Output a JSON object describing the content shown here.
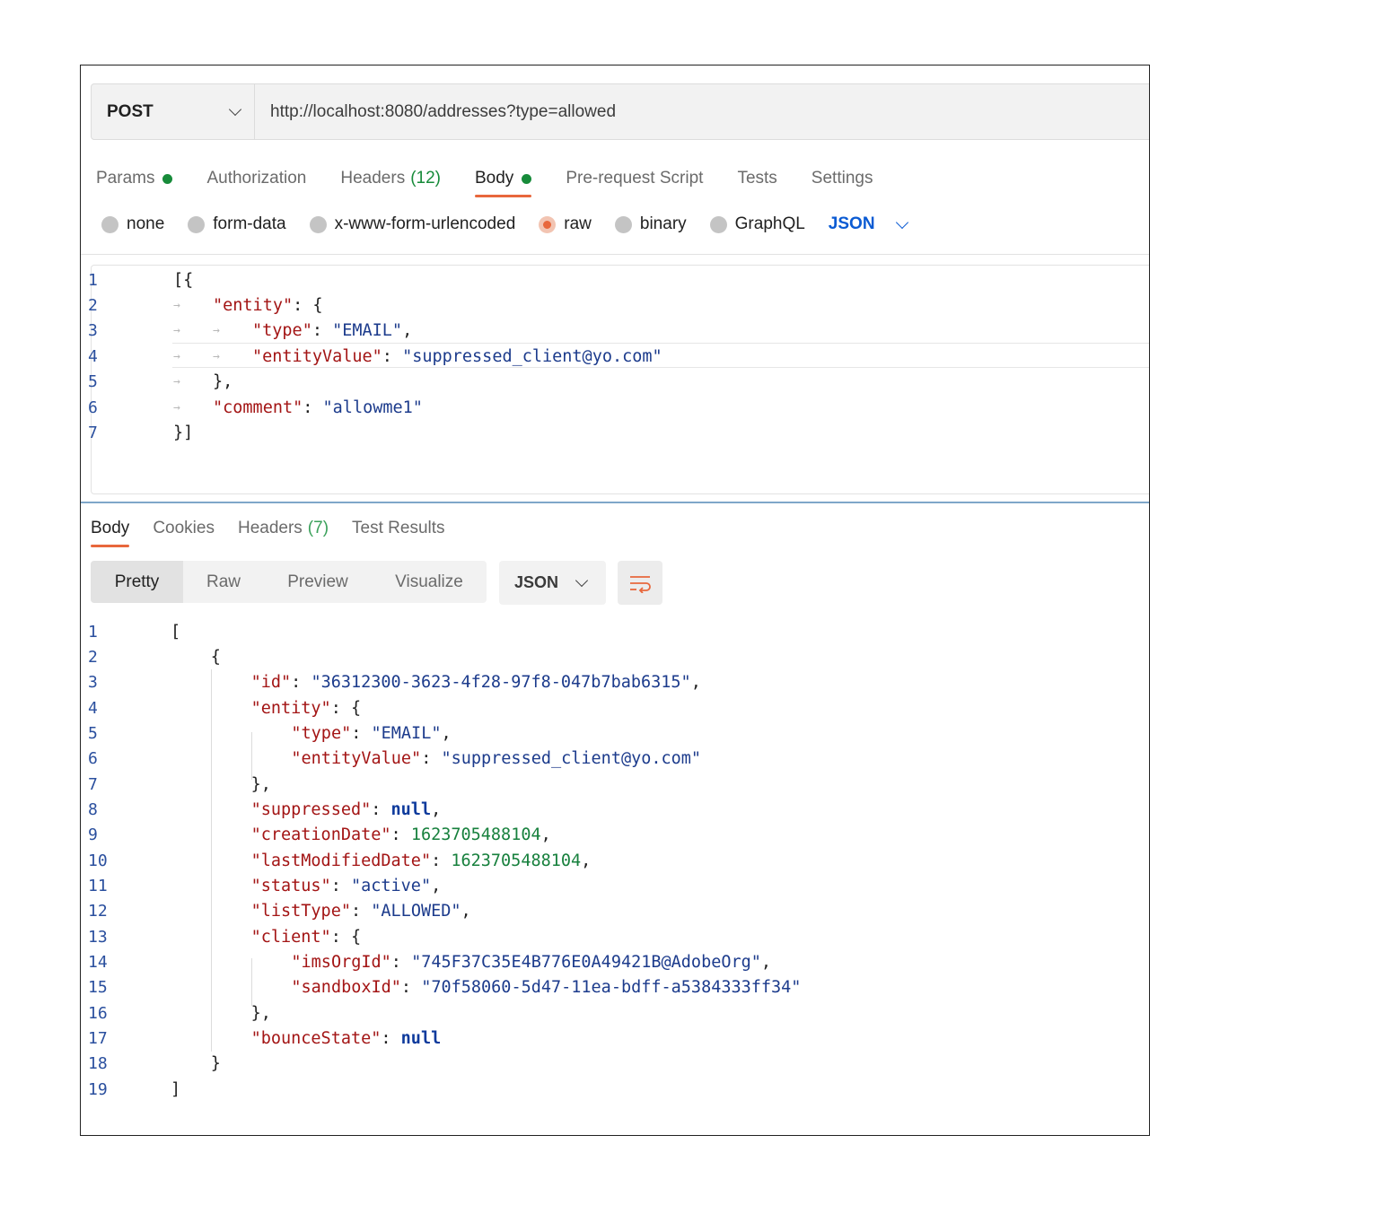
{
  "request": {
    "method": "POST",
    "url": "http://localhost:8080/addresses?type=allowed"
  },
  "request_tabs": [
    {
      "label": "Params",
      "dot": true
    },
    {
      "label": "Authorization"
    },
    {
      "label": "Headers",
      "count": "(12)"
    },
    {
      "label": "Body",
      "dot": true,
      "active": true
    },
    {
      "label": "Pre-request Script"
    },
    {
      "label": "Tests"
    },
    {
      "label": "Settings"
    }
  ],
  "body_types": {
    "options": [
      "none",
      "form-data",
      "x-www-form-urlencoded",
      "raw",
      "binary",
      "GraphQL"
    ],
    "selected": "raw",
    "language": "JSON"
  },
  "request_body": {
    "line_numbers": [
      "1",
      "2",
      "3",
      "4",
      "5",
      "6",
      "7"
    ],
    "lines": [
      [
        [
          "p",
          "[{"
        ]
      ],
      [
        [
          "k",
          "\"entity\""
        ],
        [
          "p",
          ": {"
        ]
      ],
      [
        [
          "k",
          "\"type\""
        ],
        [
          "p",
          ": "
        ],
        [
          "s",
          "\"EMAIL\""
        ],
        [
          "p",
          ","
        ]
      ],
      [
        [
          "k",
          "\"entityValue\""
        ],
        [
          "p",
          ": "
        ],
        [
          "s",
          "\"suppressed_client@yo.com\""
        ]
      ],
      [
        [
          "p",
          "},"
        ]
      ],
      [
        [
          "k",
          "\"comment\""
        ],
        [
          "p",
          ": "
        ],
        [
          "s",
          "\"allowme1\""
        ]
      ],
      [
        [
          "p",
          "}]"
        ]
      ]
    ]
  },
  "response_tabs": [
    {
      "label": "Body",
      "active": true
    },
    {
      "label": "Cookies"
    },
    {
      "label": "Headers",
      "count": "(7)"
    },
    {
      "label": "Test Results"
    }
  ],
  "view_modes": [
    "Pretty",
    "Raw",
    "Preview",
    "Visualize"
  ],
  "view_mode_selected": "Pretty",
  "response_format": "JSON",
  "response_body": {
    "line_numbers": [
      "1",
      "2",
      "3",
      "4",
      "5",
      "6",
      "7",
      "8",
      "9",
      "10",
      "11",
      "12",
      "13",
      "14",
      "15",
      "16",
      "17",
      "18",
      "19"
    ],
    "lines": [
      [
        [
          "p",
          "["
        ]
      ],
      [
        [
          "p",
          "{"
        ]
      ],
      [
        [
          "k",
          "\"id\""
        ],
        [
          "p",
          ": "
        ],
        [
          "s",
          "\"36312300-3623-4f28-97f8-047b7bab6315\""
        ],
        [
          "p",
          ","
        ]
      ],
      [
        [
          "k",
          "\"entity\""
        ],
        [
          "p",
          ": {"
        ]
      ],
      [
        [
          "k",
          "\"type\""
        ],
        [
          "p",
          ": "
        ],
        [
          "s",
          "\"EMAIL\""
        ],
        [
          "p",
          ","
        ]
      ],
      [
        [
          "k",
          "\"entityValue\""
        ],
        [
          "p",
          ": "
        ],
        [
          "s",
          "\"suppressed_client@yo.com\""
        ]
      ],
      [
        [
          "p",
          "},"
        ]
      ],
      [
        [
          "k",
          "\"suppressed\""
        ],
        [
          "p",
          ": "
        ],
        [
          "kw",
          "null"
        ],
        [
          "p",
          ","
        ]
      ],
      [
        [
          "k",
          "\"creationDate\""
        ],
        [
          "p",
          ": "
        ],
        [
          "n",
          "1623705488104"
        ],
        [
          "p",
          ","
        ]
      ],
      [
        [
          "k",
          "\"lastModifiedDate\""
        ],
        [
          "p",
          ": "
        ],
        [
          "n",
          "1623705488104"
        ],
        [
          "p",
          ","
        ]
      ],
      [
        [
          "k",
          "\"status\""
        ],
        [
          "p",
          ": "
        ],
        [
          "s",
          "\"active\""
        ],
        [
          "p",
          ","
        ]
      ],
      [
        [
          "k",
          "\"listType\""
        ],
        [
          "p",
          ": "
        ],
        [
          "s",
          "\"ALLOWED\""
        ],
        [
          "p",
          ","
        ]
      ],
      [
        [
          "k",
          "\"client\""
        ],
        [
          "p",
          ": {"
        ]
      ],
      [
        [
          "k",
          "\"imsOrgId\""
        ],
        [
          "p",
          ": "
        ],
        [
          "s",
          "\"745F37C35E4B776E0A49421B@AdobeOrg\""
        ],
        [
          "p",
          ","
        ]
      ],
      [
        [
          "k",
          "\"sandboxId\""
        ],
        [
          "p",
          ": "
        ],
        [
          "s",
          "\"70f58060-5d47-11ea-bdff-a5384333ff34\""
        ]
      ],
      [
        [
          "p",
          "},"
        ]
      ],
      [
        [
          "k",
          "\"bounceState\""
        ],
        [
          "p",
          ": "
        ],
        [
          "kw",
          "null"
        ]
      ],
      [
        [
          "p",
          "}"
        ]
      ],
      [
        [
          "p",
          "]"
        ]
      ]
    ]
  },
  "colors": {
    "accent": "#e8673c",
    "status_green": "#178b3a",
    "link_blue": "#0b5bd3",
    "json_key": "#a31515",
    "json_string": "#1c3b8c",
    "json_number": "#17803d"
  },
  "icons": {
    "method_dropdown": "chevron-down-icon",
    "language_dropdown": "chevron-down-icon",
    "format_dropdown": "chevron-down-icon",
    "wrap": "wrap-lines-icon"
  }
}
